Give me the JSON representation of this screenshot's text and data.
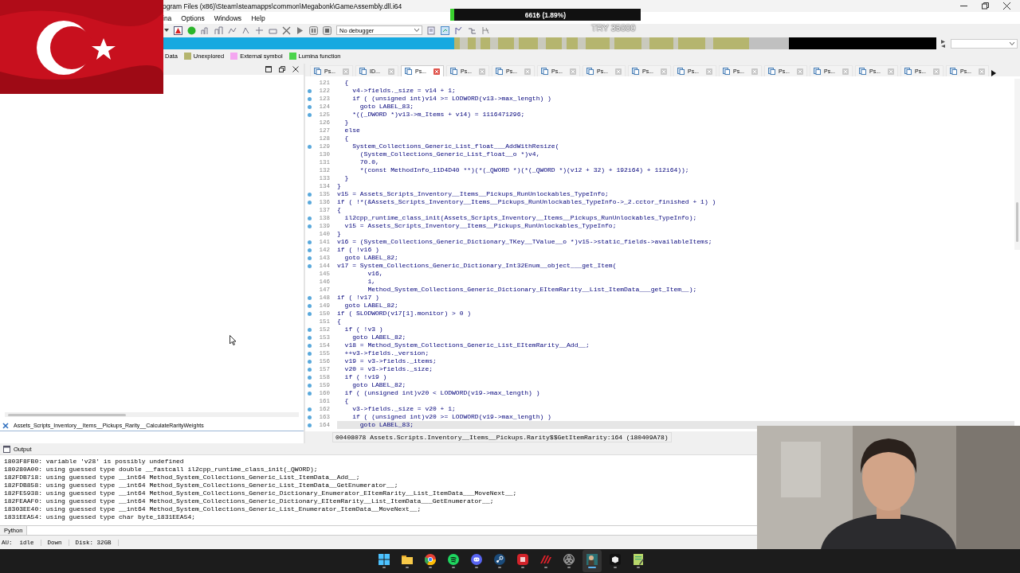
{
  "window": {
    "title": "ogram Files (x86)\\Steam\\steamapps\\common\\Megabonk\\GameAssembly.dll.i64"
  },
  "menu": [
    "ina",
    "Options",
    "Windows",
    "Help"
  ],
  "toolbar": {
    "debugger": "No debugger"
  },
  "donation_bar": {
    "amount": "661₺ (1.89%)",
    "level": 0.0189,
    "goal": "TRY 35000"
  },
  "legend": [
    {
      "label": "Data"
    },
    {
      "label": "Unexplored",
      "color": "#b5b56e"
    },
    {
      "label": "External symbol",
      "color": "#f4a6f0"
    },
    {
      "label": "Lumina function",
      "color": "#4cd44c"
    }
  ],
  "left_panel": {
    "filter": "Assets_Scripts_Inventory__Items__Pickups_Rarity__CalculateRarityWeights"
  },
  "tabs": [
    {
      "label": "Ps...",
      "selected": false
    },
    {
      "label": "ID...",
      "selected": false
    },
    {
      "label": "Ps...",
      "selected": true
    },
    {
      "label": "Ps...",
      "selected": false
    },
    {
      "label": "Ps...",
      "selected": false
    },
    {
      "label": "Ps...",
      "selected": false
    },
    {
      "label": "Ps...",
      "selected": false
    },
    {
      "label": "Ps...",
      "selected": false
    },
    {
      "label": "Ps...",
      "selected": false
    },
    {
      "label": "Ps...",
      "selected": false
    },
    {
      "label": "Ps...",
      "selected": false
    },
    {
      "label": "Ps...",
      "selected": false
    },
    {
      "label": "Ps...",
      "selected": false
    },
    {
      "label": "Ps...",
      "selected": false
    },
    {
      "label": "Ps...",
      "selected": false
    }
  ],
  "code_lines": [
    {
      "number": "121",
      "text": "  {",
      "dot": false,
      "selected": false
    },
    {
      "number": "122",
      "text": "    v4->fields._size = v14 + 1;",
      "dot": true,
      "selected": false
    },
    {
      "number": "123",
      "text": "    if ( (unsigned int)v14 >= LODWORD(v13->max_length) )",
      "dot": true,
      "selected": false
    },
    {
      "number": "124",
      "text": "      goto LABEL_83;",
      "dot": true,
      "selected": false
    },
    {
      "number": "125",
      "text": "    *((_DWORD *)v13->m_Items + v14) = 1116471296;",
      "dot": true,
      "selected": false
    },
    {
      "number": "126",
      "text": "  }",
      "dot": false,
      "selected": false
    },
    {
      "number": "127",
      "text": "  else",
      "dot": false,
      "selected": false
    },
    {
      "number": "128",
      "text": "  {",
      "dot": false,
      "selected": false
    },
    {
      "number": "129",
      "text": "    System_Collections_Generic_List_float___AddWithResize(",
      "dot": true,
      "selected": false
    },
    {
      "number": "130",
      "text": "      (System_Collections_Generic_List_float__o *)v4,",
      "dot": false,
      "selected": false
    },
    {
      "number": "131",
      "text": "      70.0,",
      "dot": false,
      "selected": false
    },
    {
      "number": "132",
      "text": "      *(const MethodInfo_11D4D40 **)(*(_QWORD *)(*(_QWORD *)(v12 + 32) + 192i64) + 112i64));",
      "dot": false,
      "selected": false
    },
    {
      "number": "133",
      "text": "  }",
      "dot": false,
      "selected": false
    },
    {
      "number": "134",
      "text": "}",
      "dot": false,
      "selected": false
    },
    {
      "number": "135",
      "text": "v15 = Assets_Scripts_Inventory__Items__Pickups_RunUnlockables_TypeInfo;",
      "dot": true,
      "selected": false
    },
    {
      "number": "136",
      "text": "if ( !*(&Assets_Scripts_Inventory__Items__Pickups_RunUnlockables_TypeInfo->_2.cctor_finished + 1) )",
      "dot": true,
      "selected": false
    },
    {
      "number": "137",
      "text": "{",
      "dot": false,
      "selected": false
    },
    {
      "number": "138",
      "text": "  il2cpp_runtime_class_init(Assets_Scripts_Inventory__Items__Pickups_RunUnlockables_TypeInfo);",
      "dot": true,
      "selected": false
    },
    {
      "number": "139",
      "text": "  v15 = Assets_Scripts_Inventory__Items__Pickups_RunUnlockables_TypeInfo;",
      "dot": true,
      "selected": false
    },
    {
      "number": "140",
      "text": "}",
      "dot": false,
      "selected": false
    },
    {
      "number": "141",
      "text": "v16 = (System_Collections_Generic_Dictionary_TKey__TValue__o *)v15->static_fields->availableItems;",
      "dot": true,
      "selected": false
    },
    {
      "number": "142",
      "text": "if ( !v16 )",
      "dot": true,
      "selected": false
    },
    {
      "number": "143",
      "text": "  goto LABEL_82;",
      "dot": true,
      "selected": false
    },
    {
      "number": "144",
      "text": "v17 = System_Collections_Generic_Dictionary_Int32Enum__object___get_Item(",
      "dot": true,
      "selected": false
    },
    {
      "number": "145",
      "text": "        v16,",
      "dot": false,
      "selected": false
    },
    {
      "number": "146",
      "text": "        1,",
      "dot": false,
      "selected": false
    },
    {
      "number": "147",
      "text": "        Method_System_Collections_Generic_Dictionary_EItemRarity__List_ItemData___get_Item__);",
      "dot": false,
      "selected": false
    },
    {
      "number": "148",
      "text": "if ( !v17 )",
      "dot": true,
      "selected": false
    },
    {
      "number": "149",
      "text": "  goto LABEL_82;",
      "dot": true,
      "selected": false
    },
    {
      "number": "150",
      "text": "if ( SLODWORD(v17[1].monitor) > 0 )",
      "dot": true,
      "selected": false
    },
    {
      "number": "151",
      "text": "{",
      "dot": false,
      "selected": false
    },
    {
      "number": "152",
      "text": "  if ( !v3 )",
      "dot": true,
      "selected": false
    },
    {
      "number": "153",
      "text": "    goto LABEL_82;",
      "dot": true,
      "selected": false
    },
    {
      "number": "154",
      "text": "  v18 = Method_System_Collections_Generic_List_EItemRarity__Add__;",
      "dot": true,
      "selected": false
    },
    {
      "number": "155",
      "text": "  ++v3->fields._version;",
      "dot": true,
      "selected": false
    },
    {
      "number": "156",
      "text": "  v19 = v3->fields._items;",
      "dot": true,
      "selected": false
    },
    {
      "number": "157",
      "text": "  v20 = v3->fields._size;",
      "dot": true,
      "selected": false
    },
    {
      "number": "158",
      "text": "  if ( !v19 )",
      "dot": true,
      "selected": false
    },
    {
      "number": "159",
      "text": "    goto LABEL_82;",
      "dot": true,
      "selected": false
    },
    {
      "number": "160",
      "text": "  if ( (unsigned int)v20 < LODWORD(v19->max_length) )",
      "dot": true,
      "selected": false
    },
    {
      "number": "161",
      "text": "  {",
      "dot": false,
      "selected": false
    },
    {
      "number": "162",
      "text": "    v3->fields._size = v20 + 1;",
      "dot": true,
      "selected": false
    },
    {
      "number": "163",
      "text": "    if ( (unsigned int)v20 >= LODWORD(v19->max_length) )",
      "dot": true,
      "selected": false
    },
    {
      "number": "164",
      "text": "      goto LABEL_83;",
      "dot": true,
      "selected": true
    }
  ],
  "location": "00408078 Assets.Scripts.Inventory__Items__Pickups.Rarity$$GetItemRarity:164 (180409A78)",
  "output": {
    "title": "Output",
    "lines": [
      "1803F8FB0: variable 'v28' is possibly undefined",
      "180280A00: using guessed type double __fastcall il2cpp_runtime_class_init(_QWORD);",
      "182FDB718: using guessed type __int64 Method_System_Collections_Generic_List_ItemData__Add__;",
      "182FDB858: using guessed type __int64 Method_System_Collections_Generic_List_ItemData__GetEnumerator__;",
      "182FE5938: using guessed type __int64 Method_System_Collections_Generic_Dictionary_Enumerator_EItemRarity__List_ItemData___MoveNext__;",
      "182FEAAF0: using guessed type __int64 Method_System_Collections_Generic_Dictionary_EItemRarity__List_ItemData___GetEnumerator__;",
      "18303EE40: using guessed type __int64 Method_System_Collections_Generic_List_Enumerator_ItemData__MoveNext__;",
      "1831EEA54: using guessed type char byte_1831EEA54;"
    ]
  },
  "python": {
    "label": "Python"
  },
  "status_bar": [
    "AU:  idle",
    "Down",
    "Disk: 32GB"
  ],
  "taskbar": [
    {
      "kind": "start",
      "active": false
    },
    {
      "kind": "folder",
      "active": false
    },
    {
      "kind": "browser",
      "active": false
    },
    {
      "kind": "music",
      "active": false
    },
    {
      "kind": "chat",
      "active": false
    },
    {
      "kind": "launcher",
      "active": false
    },
    {
      "kind": "red",
      "active": false
    },
    {
      "kind": "stripes",
      "active": false
    },
    {
      "kind": "recorder",
      "active": false
    },
    {
      "kind": "disassembler",
      "active": true
    },
    {
      "kind": "cube",
      "active": false
    },
    {
      "kind": "editor",
      "active": false
    }
  ]
}
